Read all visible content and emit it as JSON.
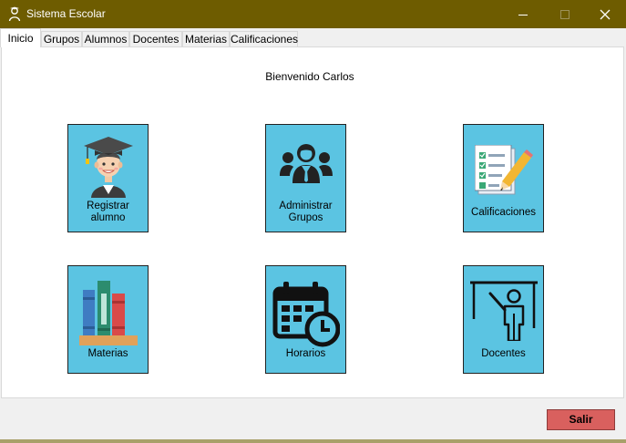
{
  "window": {
    "title": "Sistema Escolar",
    "accent": "#6e5c00",
    "controls": {
      "minimize": "minimize-icon",
      "maximize": "maximize-icon",
      "close": "close-icon"
    }
  },
  "tabs": [
    {
      "label": "Inicio",
      "active": true
    },
    {
      "label": "Grupos"
    },
    {
      "label": "Alumnos"
    },
    {
      "label": "Docentes"
    },
    {
      "label": "Materias"
    },
    {
      "label": "Calificaciones"
    }
  ],
  "main": {
    "welcome": "Bienvenido Carlos",
    "tiles": [
      {
        "label_1": "Registrar",
        "label_2": "alumno",
        "icon": "graduate-student-icon"
      },
      {
        "label_1": "Administrar",
        "label_2": "Grupos",
        "icon": "group-users-icon"
      },
      {
        "label": "Calificaciones",
        "icon": "graded-checklist-icon"
      },
      {
        "label": "Materias",
        "icon": "books-icon"
      },
      {
        "label": "Horarios",
        "icon": "calendar-clock-icon"
      },
      {
        "label": "Docentes",
        "icon": "teacher-board-icon"
      }
    ],
    "tile_color": "#5bc4e2"
  },
  "footer": {
    "exit_label": "Salir",
    "exit_color": "#d9605e"
  }
}
